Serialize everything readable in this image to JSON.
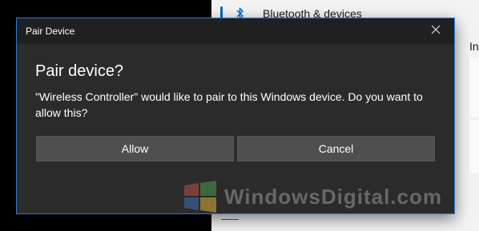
{
  "background": {
    "nav_item": {
      "label": "Bluetooth & devices",
      "icon": "bluetooth-icon"
    },
    "right_partial_text": "In"
  },
  "dialog": {
    "title": "Pair Device",
    "close_icon": "close-icon",
    "heading": "Pair device?",
    "message": "\"Wireless Controller\" would like to pair to this Windows device. Do you want to allow this?",
    "buttons": {
      "allow": "Allow",
      "cancel": "Cancel"
    },
    "accent_color": "#2e7bd6"
  },
  "watermark": {
    "text": "WindowsDigital.com",
    "logo_icon": "windows-logo-icon"
  }
}
